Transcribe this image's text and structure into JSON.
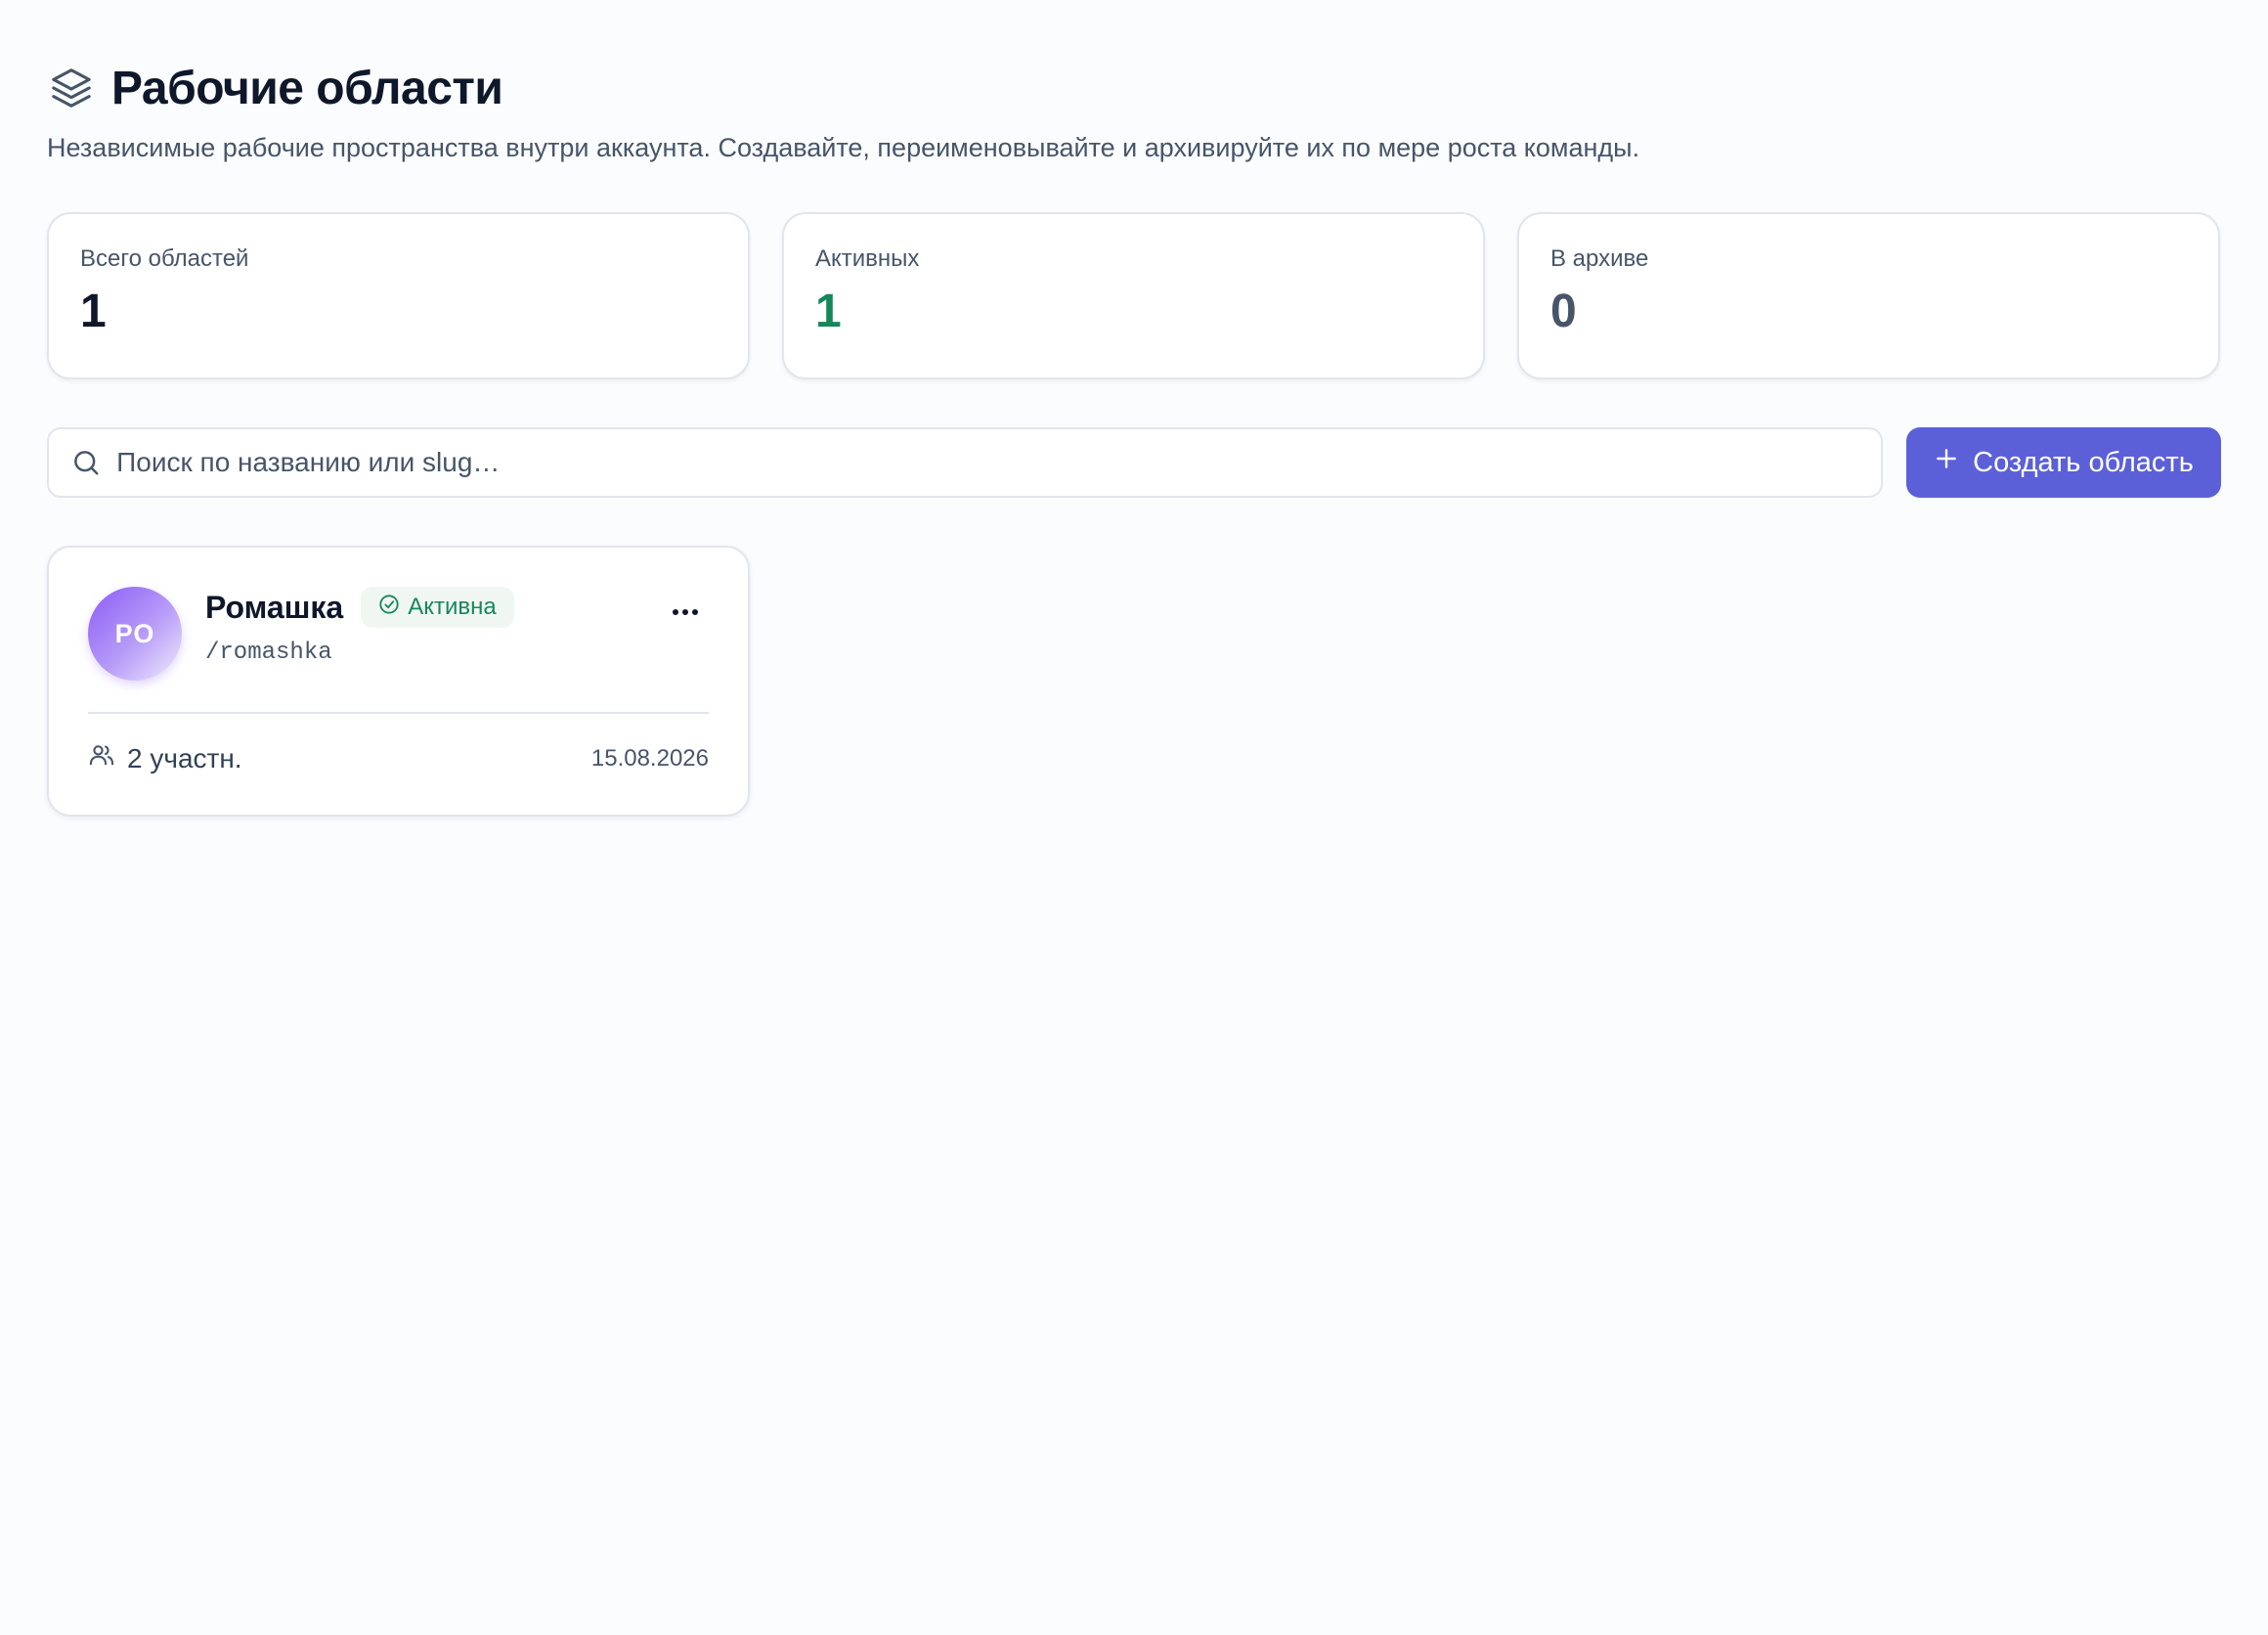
{
  "header": {
    "title": "Рабочие области",
    "subtitle": "Независимые рабочие пространства внутри аккаунта. Создавайте, переименовывайте и архивируйте их по мере роста команды.",
    "icon": "layers-icon"
  },
  "stats": [
    {
      "label": "Всего областей",
      "value": "1",
      "color": "#0f172a"
    },
    {
      "label": "Активных",
      "value": "1",
      "color": "#15875a"
    },
    {
      "label": "В архиве",
      "value": "0",
      "color": "#475569"
    }
  ],
  "search": {
    "placeholder": "Поиск по названию или slug…",
    "value": "",
    "icon": "search-icon"
  },
  "create_button": {
    "label": "Создать область",
    "icon": "plus-icon",
    "color": "#5b60d9"
  },
  "workspaces": [
    {
      "initials": "РО",
      "name": "Ромашка",
      "status": "Активна",
      "status_color": "#16885a",
      "slug": "/romashka",
      "members": "2 участн.",
      "date": "15.08.2026",
      "menu_label": "···"
    }
  ]
}
